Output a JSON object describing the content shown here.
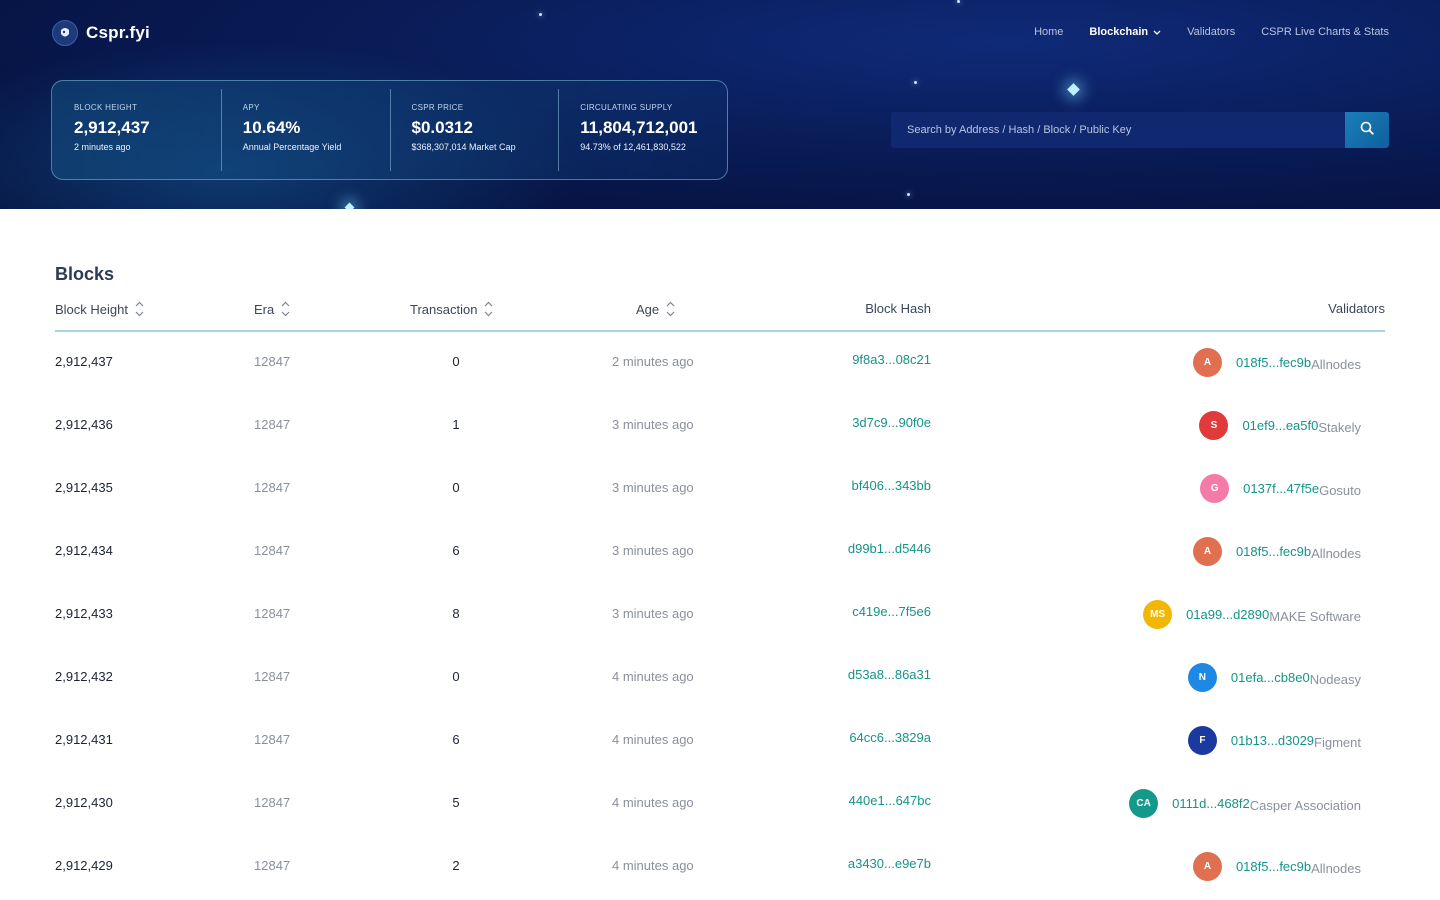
{
  "brand": {
    "name": "Cspr.fyi"
  },
  "nav": {
    "home": "Home",
    "blockchain": "Blockchain",
    "validators": "Validators",
    "stats": "CSPR Live Charts & Stats"
  },
  "stats": [
    {
      "label": "BLOCK HEIGHT",
      "value": "2,912,437",
      "sub": "2 minutes ago"
    },
    {
      "label": "APY",
      "value": "10.64%",
      "sub": "Annual Percentage Yield"
    },
    {
      "label": "CSPR PRICE",
      "value": "$0.0312",
      "sub": "$368,307,014 Market Cap"
    },
    {
      "label": "CIRCULATING SUPPLY",
      "value": "11,804,712,001",
      "sub": "94.73% of 12,461,830,522"
    }
  ],
  "search": {
    "placeholder": "Search by Address / Hash / Block / Public Key"
  },
  "blocks": {
    "title": "Blocks",
    "columns": {
      "height": "Block Height",
      "era": "Era",
      "transaction": "Transaction",
      "age": "Age",
      "hash": "Block Hash",
      "validators": "Validators"
    },
    "rows": [
      {
        "height": "2,912,437",
        "era": "12847",
        "tx": "0",
        "age": "2 minutes ago",
        "hash": "9f8a3...08c21",
        "avatar": "A",
        "avatar_color": "#e07050",
        "val_key": "018f5...fec9b",
        "val_name": "Allnodes"
      },
      {
        "height": "2,912,436",
        "era": "12847",
        "tx": "1",
        "age": "3 minutes ago",
        "hash": "3d7c9...90f0e",
        "avatar": "S",
        "avatar_color": "#e03a3a",
        "val_key": "01ef9...ea5f0",
        "val_name": "Stakely"
      },
      {
        "height": "2,912,435",
        "era": "12847",
        "tx": "0",
        "age": "3 minutes ago",
        "hash": "bf406...343bb",
        "avatar": "G",
        "avatar_color": "#f47aa8",
        "val_key": "0137f...47f5e",
        "val_name": "Gosuto"
      },
      {
        "height": "2,912,434",
        "era": "12847",
        "tx": "6",
        "age": "3 minutes ago",
        "hash": "d99b1...d5446",
        "avatar": "A",
        "avatar_color": "#e07050",
        "val_key": "018f5...fec9b",
        "val_name": "Allnodes"
      },
      {
        "height": "2,912,433",
        "era": "12847",
        "tx": "8",
        "age": "3 minutes ago",
        "hash": "c419e...7f5e6",
        "avatar": "MS",
        "avatar_color": "#f2b705",
        "val_key": "01a99...d2890",
        "val_name": "MAKE Software"
      },
      {
        "height": "2,912,432",
        "era": "12847",
        "tx": "0",
        "age": "4 minutes ago",
        "hash": "d53a8...86a31",
        "avatar": "N",
        "avatar_color": "#1e88e5",
        "val_key": "01efa...cb8e0",
        "val_name": "Nodeasy"
      },
      {
        "height": "2,912,431",
        "era": "12847",
        "tx": "6",
        "age": "4 minutes ago",
        "hash": "64cc6...3829a",
        "avatar": "F",
        "avatar_color": "#1a3aa0",
        "val_key": "01b13...d3029",
        "val_name": "Figment"
      },
      {
        "height": "2,912,430",
        "era": "12847",
        "tx": "5",
        "age": "4 minutes ago",
        "hash": "440e1...647bc",
        "avatar": "CA",
        "avatar_color": "#14998a",
        "val_key": "0111d...468f2",
        "val_name": "Casper Association"
      },
      {
        "height": "2,912,429",
        "era": "12847",
        "tx": "2",
        "age": "4 minutes ago",
        "hash": "a3430...e9e7b",
        "avatar": "A",
        "avatar_color": "#e07050",
        "val_key": "018f5...fec9b",
        "val_name": "Allnodes"
      }
    ]
  }
}
